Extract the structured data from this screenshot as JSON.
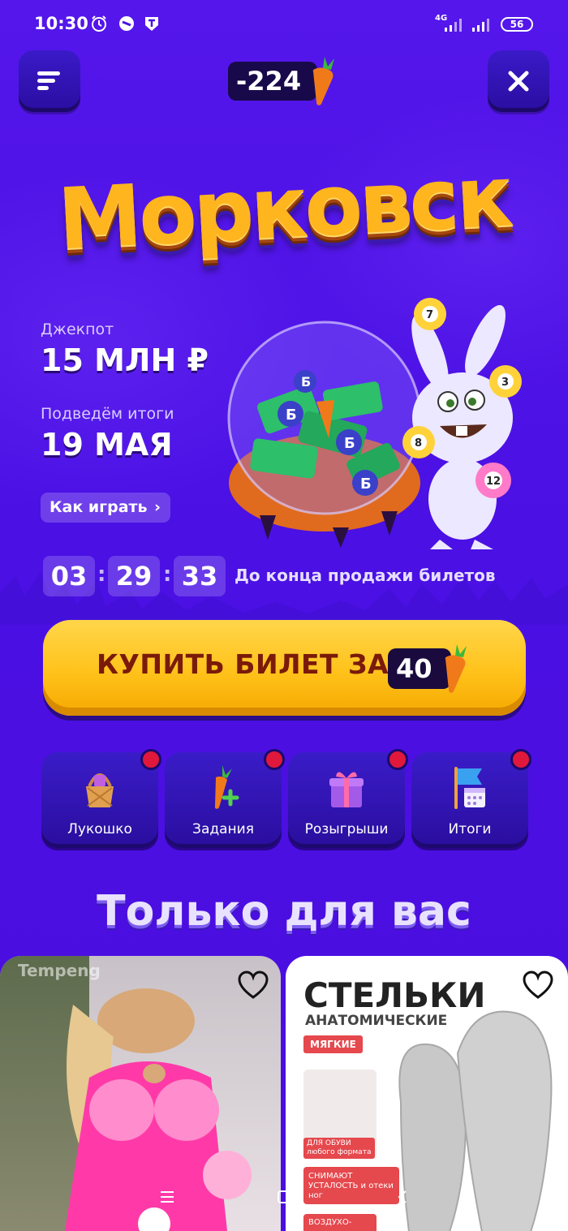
{
  "status_bar": {
    "time": "10:30",
    "network": "4G",
    "battery": "56"
  },
  "header": {
    "balance": "-224"
  },
  "game": {
    "title": "Морковск",
    "jackpot_label": "Джекпот",
    "jackpot_value": "15 МЛН ₽",
    "results_label": "Подведём итоги",
    "results_date": "19 МАЯ",
    "how_to_play": "Как играть",
    "timer": {
      "hours": "03",
      "minutes": "29",
      "seconds": "33",
      "label": "До конца продажи билетов"
    },
    "buy_button": {
      "label": "КУПИТЬ БИЛЕТ ЗА",
      "price": "40"
    }
  },
  "tiles": [
    {
      "label": "Лукошко",
      "icon": "basket-icon"
    },
    {
      "label": "Задания",
      "icon": "carrot-plus-icon"
    },
    {
      "label": "Розыгрыши",
      "icon": "gift-icon"
    },
    {
      "label": "Итоги",
      "icon": "flag-calendar-icon"
    }
  ],
  "section": {
    "title": "Только для вас"
  },
  "products": [
    {
      "watermark": "Tempeng",
      "icon": "heart-icon"
    },
    {
      "headline": "СТЕЛЬКИ",
      "subheadline": "АНАТОМИЧЕСКИЕ",
      "badge": "МЯГКИЕ",
      "feature1": "ДЛЯ ОБУВИ любого формата",
      "feature2": "СНИМАЮТ УСТАЛОСТЬ и отеки ног",
      "feature3": "ВОЗДУХО-",
      "icon": "heart-icon"
    }
  ],
  "colors": {
    "background": "#4a12e6",
    "accent_yellow": "#ffc21a",
    "tile_bg": "#2f12b4",
    "badge_red": "#e0183c"
  }
}
